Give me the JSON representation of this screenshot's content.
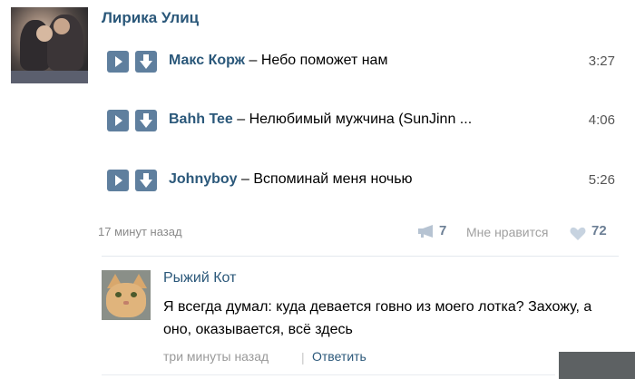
{
  "post": {
    "author": "Лирика Улиц",
    "tracks": [
      {
        "artist": "Макс Корж",
        "separator": " – ",
        "title": "Небо поможет нам",
        "duration": "3:27"
      },
      {
        "artist": "Bahh Tee",
        "separator": " – ",
        "title": "Нелюбимый мужчина (SunJinn ...",
        "duration": "4:06"
      },
      {
        "artist": "Johnyboy",
        "separator": " – ",
        "title": "Вспоминай меня ночью",
        "duration": "5:26"
      }
    ],
    "time": "17 минут назад",
    "share_count": "7",
    "like_label": "Мне нравится",
    "like_count": "72"
  },
  "comment": {
    "author": "Рыжий Кот",
    "text": "Я всегда думал: куда девается говно из моего лотка? Захожу, а оно, оказывается, всё здесь",
    "time": "три минуты назад",
    "separator": "|",
    "reply_label": "Ответить"
  },
  "colors": {
    "link": "#2b587a",
    "button": "#5f7f9e",
    "muted": "#8a8a8a"
  },
  "icons": [
    "play-icon",
    "download-icon",
    "megaphone-icon",
    "heart-icon"
  ]
}
